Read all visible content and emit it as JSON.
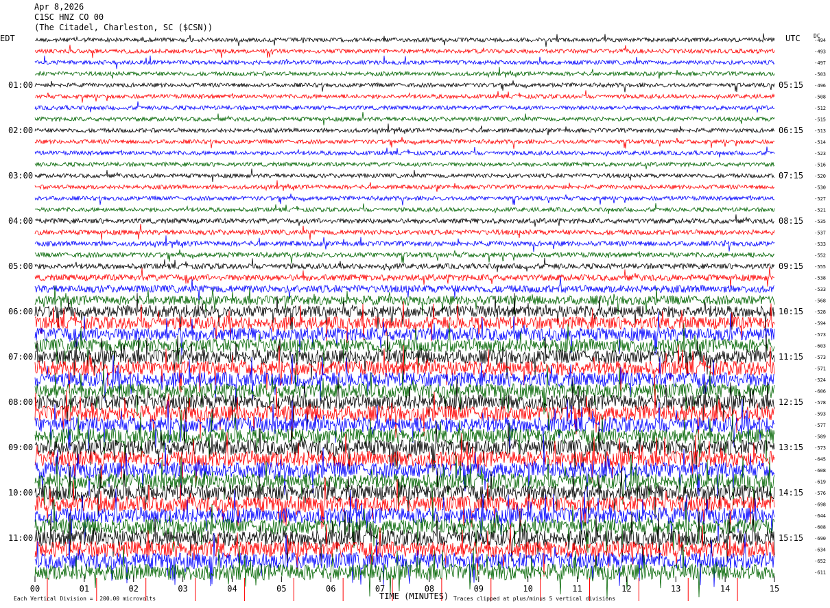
{
  "header": {
    "date": "Apr 8,2026",
    "station": "C1SC HNZ CO 00",
    "location": "(The Citadel, Charleston, SC ($CSN))"
  },
  "labels": {
    "left_zone": "EDT",
    "right_zone": "UTC",
    "dc_label": "DC",
    "x_axis_title": "TIME (MINUTES)",
    "scale_note": "Each Vertical Division =  200.00 microvolts",
    "clip_note": "Traces clipped at plus/minus 5 vertical divisions"
  },
  "colors": {
    "trace_cycle": [
      "#000000",
      "#ff0000",
      "#0000ff",
      "#006400"
    ],
    "minute_marker": "#ff0000",
    "background": "#ffffff"
  },
  "chart_data": {
    "type": "line",
    "title": "C1SC HNZ CO 00",
    "xlabel": "TIME (MINUTES)",
    "xlim": [
      0,
      15
    ],
    "x_ticks": [
      "00",
      "01",
      "02",
      "03",
      "04",
      "05",
      "06",
      "07",
      "08",
      "09",
      "10",
      "11",
      "12",
      "13",
      "14",
      "15"
    ],
    "row_count": 48,
    "row_interval_minutes": 15,
    "left_hour_labels": [
      "01:00",
      "02:00",
      "03:00",
      "04:00",
      "05:00",
      "06:00",
      "07:00",
      "08:00",
      "09:00",
      "10:00",
      "11:00"
    ],
    "right_hour_labels": [
      "05:15",
      "06:15",
      "07:15",
      "08:15",
      "09:15",
      "10:15",
      "11:15",
      "12:15",
      "13:15",
      "14:15",
      "15:15"
    ],
    "hour_label_rows": [
      4,
      8,
      12,
      16,
      20,
      24,
      28,
      32,
      36,
      40,
      44
    ],
    "dc_offsets": [
      -494,
      -493,
      -497,
      -503,
      -496,
      -508,
      -512,
      -515,
      -513,
      -514,
      -523,
      -516,
      -520,
      -530,
      -527,
      -521,
      -535,
      -537,
      -533,
      -552,
      -555,
      -538,
      -533,
      -568,
      -528,
      -594,
      -573,
      -603,
      -573,
      -571,
      -524,
      -606,
      -578,
      -593,
      -577,
      -589,
      -573,
      -645,
      -608,
      -619,
      -576,
      -698,
      -644,
      -608,
      -690,
      -634,
      -652,
      -611
    ],
    "noise_level_by_row": [
      1.0,
      1.0,
      1.0,
      1.0,
      1.0,
      1.0,
      1.0,
      1.0,
      1.0,
      1.0,
      1.0,
      1.0,
      1.0,
      1.0,
      1.0,
      1.0,
      1.2,
      1.2,
      1.2,
      1.2,
      1.3,
      1.5,
      1.8,
      2.2,
      2.8,
      3.0,
      3.2,
      3.3,
      3.4,
      3.5,
      3.5,
      3.6,
      3.6,
      3.7,
      3.7,
      3.7,
      3.8,
      3.8,
      3.8,
      3.8,
      3.8,
      3.8,
      3.8,
      3.8,
      3.9,
      3.9,
      3.9,
      3.9
    ]
  }
}
